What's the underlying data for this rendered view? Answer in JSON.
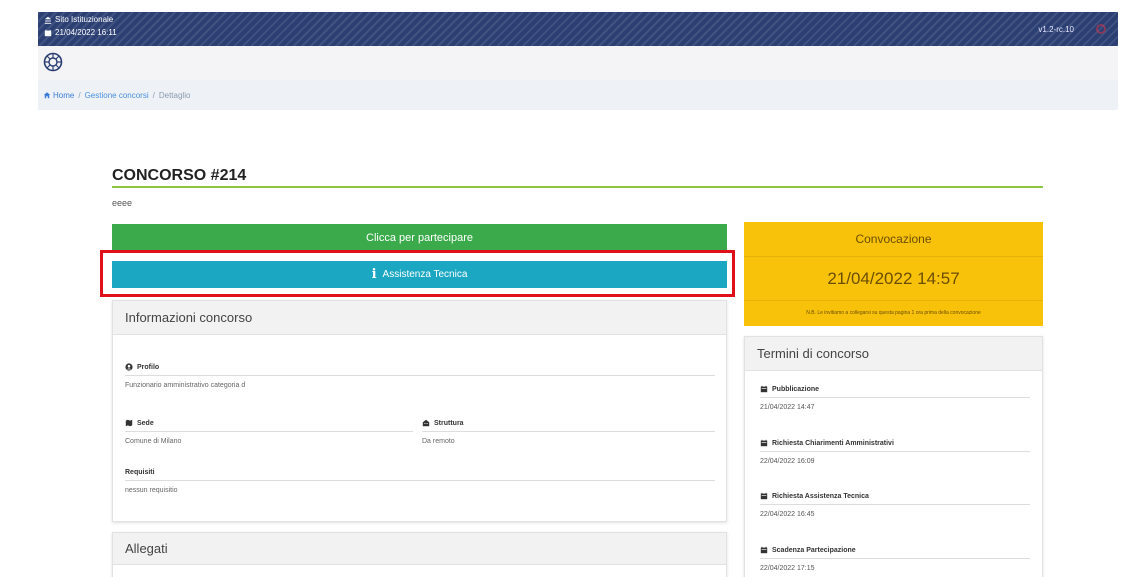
{
  "topbar": {
    "org": "Sito Istituzionale",
    "datetime": "21/04/2022 16:11",
    "version": "v1.2-rc.10"
  },
  "breadcrumb": {
    "home": "Home",
    "sep": "/",
    "item1": "Gestione concorsi",
    "item2": "Dettaglio"
  },
  "concorso": {
    "title": "CONCORSO #214",
    "description": "eeee"
  },
  "actions": {
    "partecipa": "Clicca per partecipare",
    "assistenza": "Assistenza Tecnica"
  },
  "info": {
    "title": "Informazioni concorso",
    "profilo_label": "Profilo",
    "profilo_value": "Funzionario amministrativo categoria d",
    "sede_label": "Sede",
    "sede_value": "Comune di Milano",
    "struttura_label": "Struttura",
    "struttura_value": "Da remoto",
    "requisiti_label": "Requisiti",
    "requisiti_value": "nessun requisitio"
  },
  "allegati": {
    "title": "Allegati"
  },
  "convocazione": {
    "title": "Convocazione",
    "date": "21/04/2022 14:57",
    "note": "N.B. Le invitiamo a collegarsi su questa pagina 1 ora prima della convocazione"
  },
  "termini": {
    "title": "Termini di concorso",
    "items": [
      {
        "label": "Pubblicazione",
        "value": "21/04/2022 14:47"
      },
      {
        "label": "Richiesta Chiarimenti Amministrativi",
        "value": "22/04/2022 16:09"
      },
      {
        "label": "Richiesta Assistenza Tecnica",
        "value": "22/04/2022 16:45"
      },
      {
        "label": "Scadenza Partecipazione",
        "value": "22/04/2022 17:15"
      }
    ]
  },
  "colors": {
    "topbar": "#2b3f73",
    "partecipa": "#3aaa4a",
    "assistenza": "#1ba7c2",
    "convocazione": "#f8c20a",
    "highlight": "#e0101a",
    "title_underline": "#8cc63f"
  }
}
